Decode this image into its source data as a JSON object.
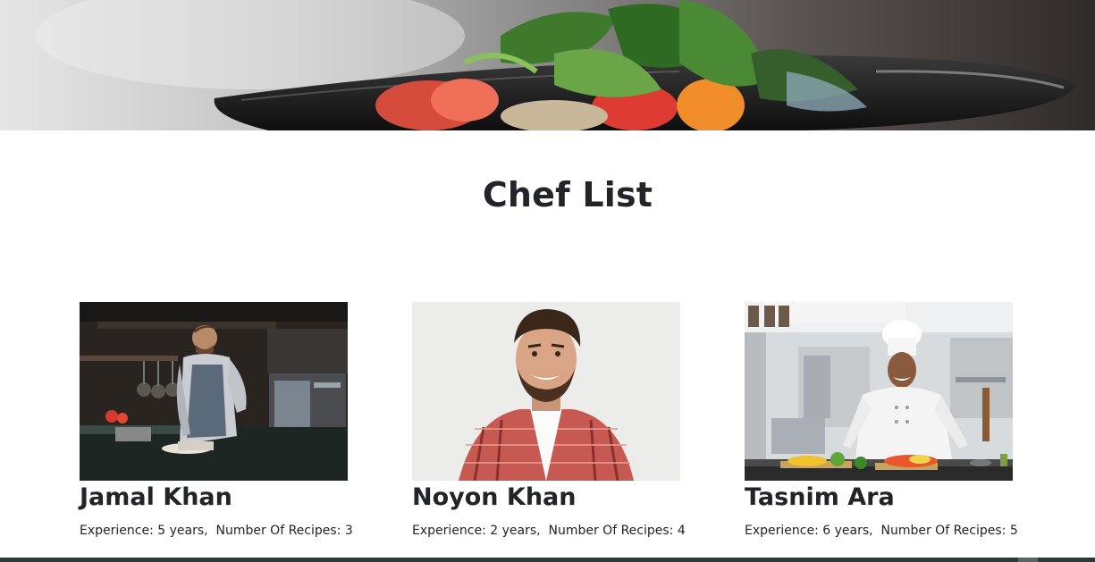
{
  "hero": {
    "image_icon": "salad-plate-banner"
  },
  "page_title": "Chef List",
  "chefs": [
    {
      "name": "Jamal Khan",
      "experience": "Experience: 5 years,",
      "recipes": "Number Of Recipes: 3",
      "photo_icon": "chef-in-kitchen-photo"
    },
    {
      "name": "Noyon Khan",
      "experience": "Experience: 2 years,",
      "recipes": "Number Of Recipes: 4",
      "photo_icon": "smiling-man-portrait-photo"
    },
    {
      "name": "Tasnim Ara",
      "experience": "Experience: 6 years,",
      "recipes": "Number Of Recipes: 5",
      "photo_icon": "woman-chef-kitchen-photo"
    }
  ]
}
